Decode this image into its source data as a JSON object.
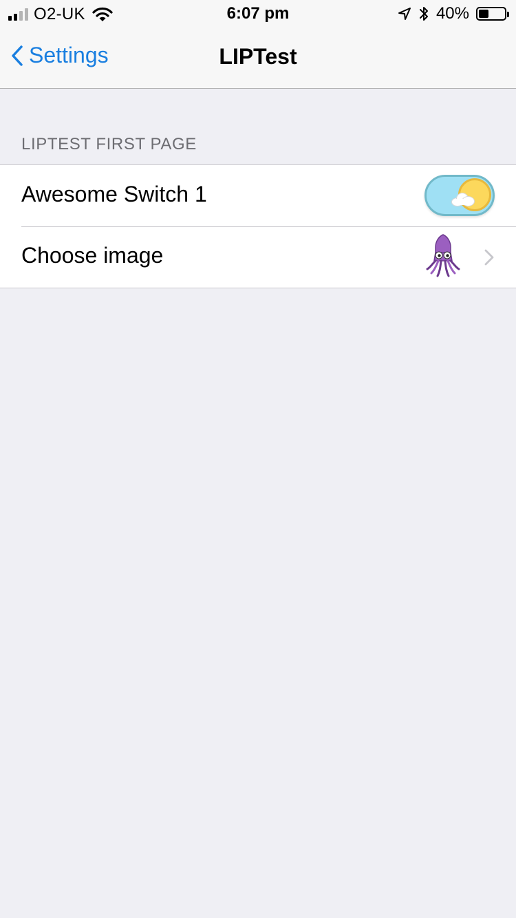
{
  "status_bar": {
    "carrier": "O2-UK",
    "time": "6:07 pm",
    "battery_text": "40%",
    "battery_level": 0.4,
    "signal_strength": 2,
    "signal_total": 4
  },
  "nav": {
    "back_label": "Settings",
    "title": "LIPTest",
    "accent_color": "#1a7fe0"
  },
  "section": {
    "header": "LIPTEST FIRST PAGE"
  },
  "rows": [
    {
      "label": "Awesome Switch 1",
      "control": "switch",
      "switch_on": true,
      "icon": "sun-cloud-switch"
    },
    {
      "label": "Choose image",
      "control": "disclosure",
      "image_icon": "squid-icon"
    }
  ]
}
